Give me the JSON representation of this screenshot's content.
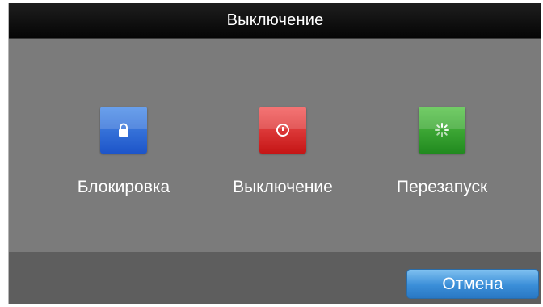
{
  "dialog": {
    "title": "Выключение"
  },
  "actions": [
    {
      "label": "Блокировка",
      "icon": "lock-icon",
      "color": "#2a66d6"
    },
    {
      "label": "Выключение",
      "icon": "power-icon",
      "color": "#d82323"
    },
    {
      "label": "Перезапуск",
      "icon": "restart-icon",
      "color": "#34a22e"
    }
  ],
  "footer": {
    "cancel_label": "Отмена"
  },
  "colors": {
    "titlebar": "#0d0d0d",
    "body": "#7b7b7b",
    "footer": "#5e5e5e",
    "cancel_button": "#3a8ed8"
  }
}
